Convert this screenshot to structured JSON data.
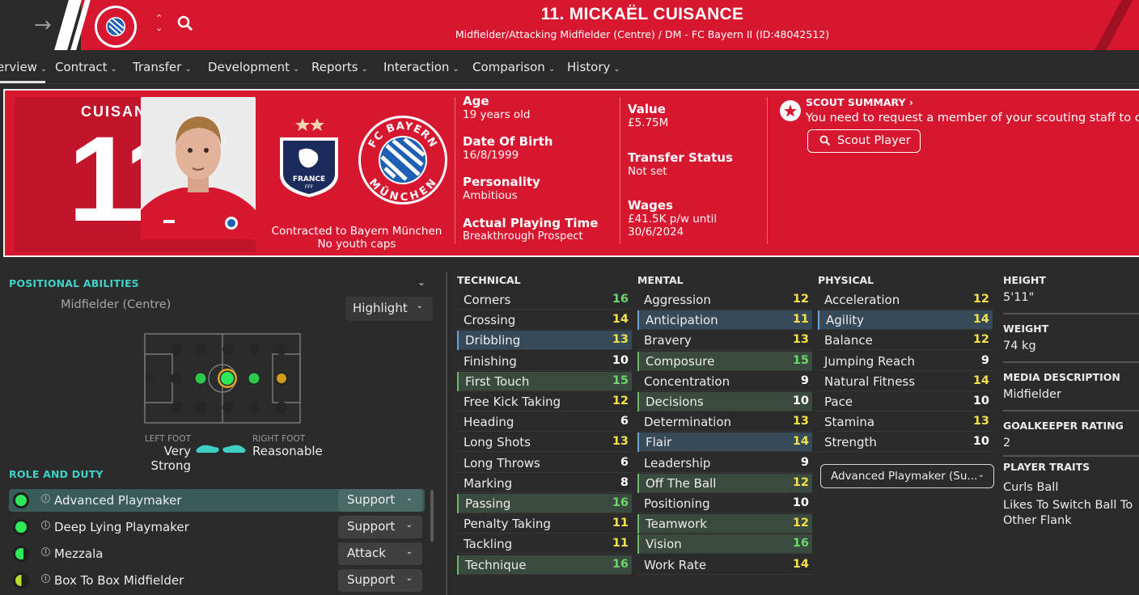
{
  "header": {
    "title": "11. MICKAËL CUISANCE",
    "subtitle": "Midfielder/Attacking Midfielder (Centre) / DM - FC Bayern II (ID:48042512)"
  },
  "nav": {
    "items": [
      {
        "label": "erview"
      },
      {
        "label": "Contract"
      },
      {
        "label": "Transfer"
      },
      {
        "label": "Development"
      },
      {
        "label": "Reports"
      },
      {
        "label": "Interaction"
      },
      {
        "label": "Comparison"
      },
      {
        "label": "History"
      }
    ]
  },
  "profile": {
    "shirt_name": "CUISAN",
    "shirt_number": "11",
    "contracted": "Contracted to Bayern München",
    "youth_caps": "No youth caps",
    "nation_badge_text": "FRANCE",
    "nation_badge_sub": "FFF",
    "club_badge_text_top": "FC BAYERN",
    "club_badge_text_bottom": "MÜNCHEN",
    "info1": [
      {
        "label": "Age",
        "value": "19 years old"
      },
      {
        "label": "Date Of Birth",
        "value": "16/8/1999"
      },
      {
        "label": "Personality",
        "value": "Ambitious"
      },
      {
        "label": "Actual Playing Time",
        "value": "Breakthrough Prospect"
      }
    ],
    "info2": [
      {
        "label": "Value",
        "value": "£5.75M"
      },
      {
        "label": "Transfer Status",
        "value": "Not set"
      },
      {
        "label": "Wages",
        "value": "£41.5K p/w until",
        "value2": "30/6/2024"
      }
    ],
    "scout": {
      "title": "SCOUT SUMMARY",
      "text": "You need to request a member of your scouting staff to co",
      "button": "Scout Player"
    }
  },
  "positional": {
    "title": "POSITIONAL ABILITIES",
    "position": "Midfielder (Centre)",
    "highlight": "Highlight",
    "left_foot_cap": "LEFT FOOT",
    "left_foot_val": "Very Strong",
    "right_foot_cap": "RIGHT FOOT",
    "right_foot_val": "Reasonable"
  },
  "roles": {
    "title": "ROLE AND DUTY",
    "items": [
      {
        "name": "Advanced Playmaker",
        "duty": "Support",
        "rating": "full"
      },
      {
        "name": "Deep Lying Playmaker",
        "duty": "Support",
        "rating": "full"
      },
      {
        "name": "Mezzala",
        "duty": "Attack",
        "rating": "most"
      },
      {
        "name": "Box To Box Midfielder",
        "duty": "Support",
        "rating": "half"
      }
    ]
  },
  "attributes": {
    "technical_title": "TECHNICAL",
    "mental_title": "MENTAL",
    "physical_title": "PHYSICAL",
    "technical": [
      {
        "name": "Corners",
        "value": "16",
        "hl": ""
      },
      {
        "name": "Crossing",
        "value": "14",
        "hl": ""
      },
      {
        "name": "Dribbling",
        "value": "13",
        "hl": "blue"
      },
      {
        "name": "Finishing",
        "value": "10",
        "hl": ""
      },
      {
        "name": "First Touch",
        "value": "15",
        "hl": "green"
      },
      {
        "name": "Free Kick Taking",
        "value": "12",
        "hl": ""
      },
      {
        "name": "Heading",
        "value": "6",
        "hl": ""
      },
      {
        "name": "Long Shots",
        "value": "13",
        "hl": ""
      },
      {
        "name": "Long Throws",
        "value": "6",
        "hl": ""
      },
      {
        "name": "Marking",
        "value": "8",
        "hl": ""
      },
      {
        "name": "Passing",
        "value": "16",
        "hl": "green"
      },
      {
        "name": "Penalty Taking",
        "value": "11",
        "hl": ""
      },
      {
        "name": "Tackling",
        "value": "11",
        "hl": ""
      },
      {
        "name": "Technique",
        "value": "16",
        "hl": "green"
      }
    ],
    "mental": [
      {
        "name": "Aggression",
        "value": "12",
        "hl": ""
      },
      {
        "name": "Anticipation",
        "value": "11",
        "hl": "blue"
      },
      {
        "name": "Bravery",
        "value": "13",
        "hl": ""
      },
      {
        "name": "Composure",
        "value": "15",
        "hl": "green"
      },
      {
        "name": "Concentration",
        "value": "9",
        "hl": ""
      },
      {
        "name": "Decisions",
        "value": "10",
        "hl": "green"
      },
      {
        "name": "Determination",
        "value": "13",
        "hl": ""
      },
      {
        "name": "Flair",
        "value": "14",
        "hl": "blue"
      },
      {
        "name": "Leadership",
        "value": "9",
        "hl": ""
      },
      {
        "name": "Off The Ball",
        "value": "12",
        "hl": "green"
      },
      {
        "name": "Positioning",
        "value": "10",
        "hl": ""
      },
      {
        "name": "Teamwork",
        "value": "12",
        "hl": "green"
      },
      {
        "name": "Vision",
        "value": "16",
        "hl": "green"
      },
      {
        "name": "Work Rate",
        "value": "14",
        "hl": ""
      }
    ],
    "physical": [
      {
        "name": "Acceleration",
        "value": "12",
        "hl": ""
      },
      {
        "name": "Agility",
        "value": "14",
        "hl": "blue"
      },
      {
        "name": "Balance",
        "value": "12",
        "hl": ""
      },
      {
        "name": "Jumping Reach",
        "value": "9",
        "hl": ""
      },
      {
        "name": "Natural Fitness",
        "value": "14",
        "hl": ""
      },
      {
        "name": "Pace",
        "value": "10",
        "hl": ""
      },
      {
        "name": "Stamina",
        "value": "13",
        "hl": ""
      },
      {
        "name": "Strength",
        "value": "10",
        "hl": ""
      }
    ],
    "role_select": "Advanced Playmaker (Su..."
  },
  "player_info": {
    "height_title": "HEIGHT",
    "height": "5'11\"",
    "weight_title": "WEIGHT",
    "weight": "74 kg",
    "media_title": "MEDIA DESCRIPTION",
    "media": "Midfielder",
    "gk_title": "GOALKEEPER RATING",
    "gk": "2",
    "traits_title": "PLAYER TRAITS",
    "trait1": "Curls Ball",
    "trait2a": "Likes To Switch Ball To",
    "trait2b": "Other Flank"
  },
  "colors": {
    "accent": "#d7172f",
    "teal": "#3fd1c6",
    "rating_white": "#ffffff",
    "rating_yellow": "#f2e14a",
    "rating_green": "#6bd66b"
  }
}
